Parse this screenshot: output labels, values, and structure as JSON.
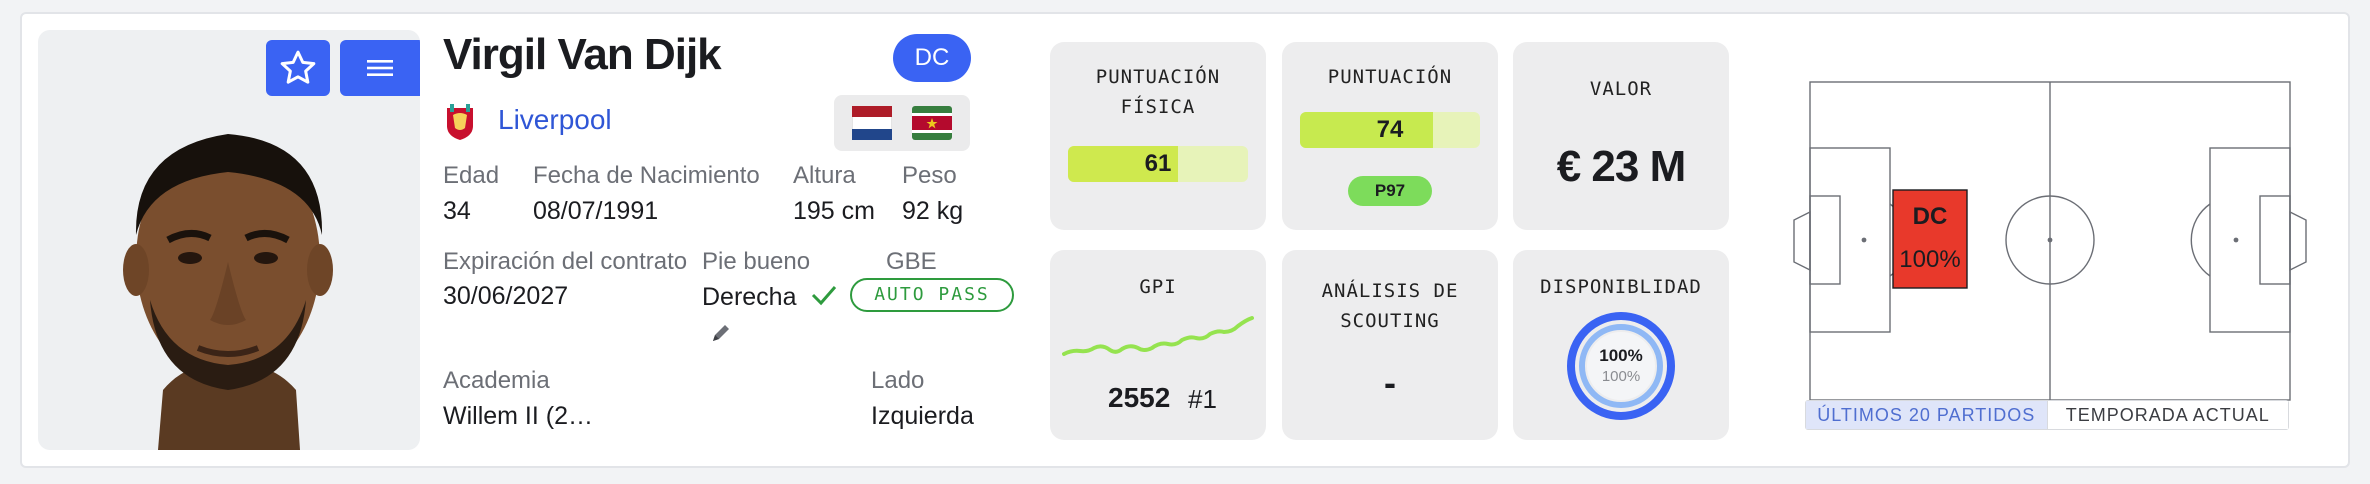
{
  "player": {
    "name": "Virgil Van Dijk",
    "position_badge": "DC",
    "club": "Liverpool"
  },
  "info": {
    "age_label": "Edad",
    "age_value": "34",
    "dob_label": "Fecha de Nacimiento",
    "dob_value": "08/07/1991",
    "height_label": "Altura",
    "height_value": "195 cm",
    "weight_label": "Peso",
    "weight_value": "92 kg",
    "contract_label": "Expiración del contrato",
    "contract_value": "30/06/2027",
    "foot_label": "Pie bueno",
    "foot_value": "Derecha",
    "gbe_label": "GBE",
    "gbe_value": "AUTO PASS",
    "academy_label": "Academia",
    "academy_value": "Willem II (2…",
    "side_label": "Lado",
    "side_value": "Izquierda"
  },
  "stats": {
    "physical": {
      "title_line1": "PUNTUACIÓN",
      "title_line2": "FÍSICA",
      "value": "61",
      "fraction": 0.61
    },
    "score": {
      "title": "PUNTUACIÓN",
      "value": "74",
      "fraction": 0.74,
      "percentile": "P97"
    },
    "market": {
      "title": "VALOR",
      "value": "€ 23 M"
    },
    "gpi": {
      "title": "GPI",
      "value": "2552",
      "rank": "#1"
    },
    "scouting": {
      "title_line1": "ANÁLISIS DE",
      "title_line2": "SCOUTING",
      "value": "-"
    },
    "availability": {
      "title": "DISPONIBLIDAD",
      "outer_value": "100%",
      "inner_value": "100%",
      "fraction": 1.0
    }
  },
  "pitch": {
    "position_label": "DC",
    "position_pct": "100%",
    "tab_recent": "ÚLTIMOS 20 PARTIDOS",
    "tab_season": "TEMPORADA ACTUAL"
  },
  "colors": {
    "accent_blue": "#3a63f3",
    "bar_fill": "#cfe94e",
    "position_red": "#e8392b",
    "gbe_green": "#2e9b3e",
    "gpi_line": "#95e34f",
    "percentile_green": "#7ddc5b"
  },
  "icons": [
    "star-icon",
    "menu-icon",
    "liverpool-crest-icon",
    "netherlands-flag-icon",
    "suriname-flag-icon",
    "check-icon",
    "pencil-icon"
  ]
}
